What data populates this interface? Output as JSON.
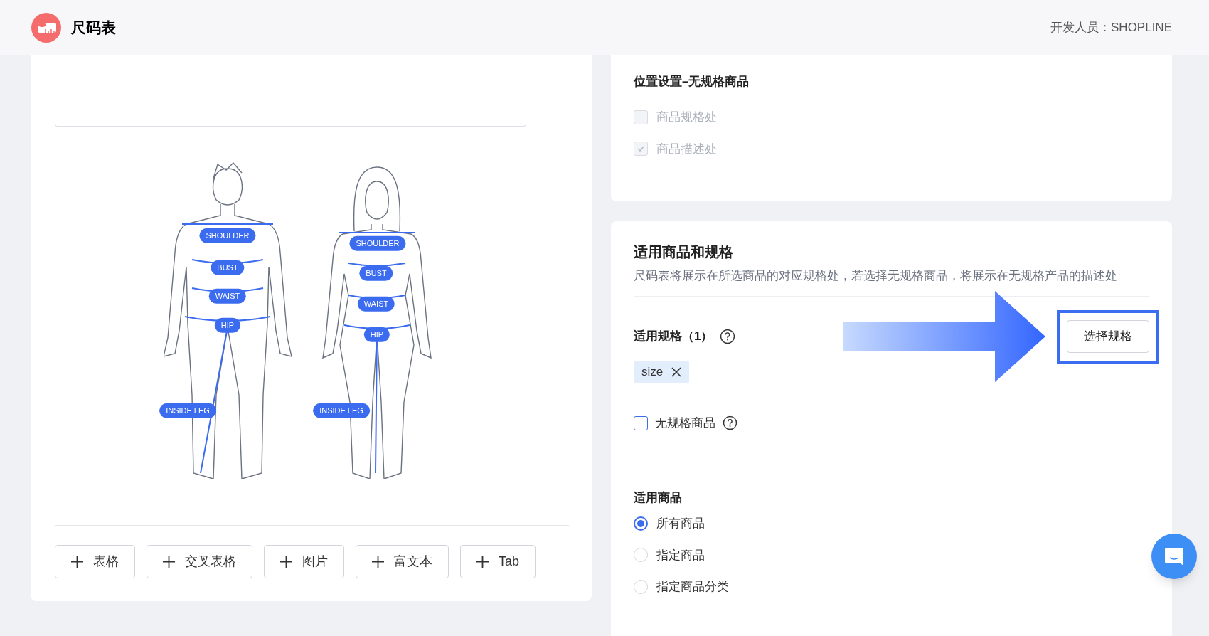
{
  "header": {
    "app_title": "尺码表",
    "developer": "开发人员：SHOPLINE"
  },
  "editor": {
    "figures": [
      {
        "kind": "male",
        "labels": [
          "SHOULDER",
          "BUST",
          "WAIST",
          "HIP",
          "INSIDE LEG"
        ]
      },
      {
        "kind": "female",
        "labels": [
          "SHOULDER",
          "BUST",
          "WAIST",
          "HIP",
          "INSIDE LEG"
        ]
      }
    ],
    "add_buttons": [
      "表格",
      "交叉表格",
      "图片",
      "富文本",
      "Tab"
    ]
  },
  "position_settings": {
    "title": "位置设置–无规格商品",
    "options": [
      {
        "label": "商品规格处",
        "checked": false,
        "disabled": true
      },
      {
        "label": "商品描述处",
        "checked": true,
        "disabled": true
      }
    ]
  },
  "applicable": {
    "title": "适用商品和规格",
    "description": "尺码表将展示在所选商品的对应规格处，若选择无规格商品，将展示在无规格产品的描述处",
    "variants_label": "适用规格（1）",
    "select_button": "选择规格",
    "tags": [
      "size"
    ],
    "no_variant": {
      "label": "无规格商品",
      "checked": false
    },
    "products_label": "适用商品",
    "product_options": [
      {
        "label": "所有商品",
        "selected": true
      },
      {
        "label": "指定商品",
        "selected": false
      },
      {
        "label": "指定商品分类",
        "selected": false
      }
    ]
  }
}
